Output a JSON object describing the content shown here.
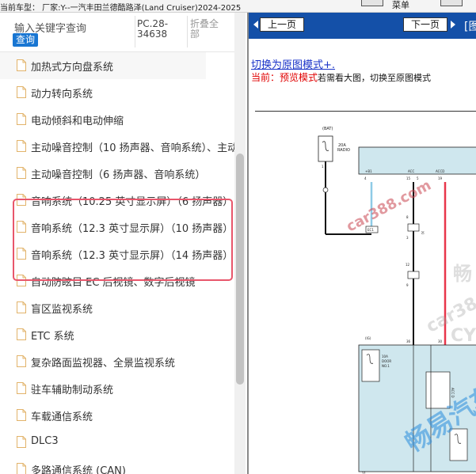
{
  "header": {
    "vehicle_info": "当前车型： 厂家:Y--一汽丰田兰德酷路泽(Land Cruiser)2024-2025",
    "menu_label": "菜单"
  },
  "sidebar": {
    "search_placeholder": "输入关键字查询",
    "search_button": "查询",
    "doc_code": "PC.28-34638",
    "fold_all": "折叠全部",
    "items": [
      {
        "label": "加热式方向盘系统"
      },
      {
        "label": "动力转向系统"
      },
      {
        "label": "电动倾斜和电动伸缩"
      },
      {
        "label": "主动噪音控制（10 扬声器、音响系统）、主动"
      },
      {
        "label": "主动噪音控制（6 扬声器、音响系统）"
      },
      {
        "label": "音响系统（10.25 英寸显示屏）（6 扬声器）"
      },
      {
        "label": "音响系统（12.3 英寸显示屏）（10 扬声器）"
      },
      {
        "label": "音响系统（12.3 英寸显示屏）（14 扬声器）"
      },
      {
        "label": "自动防眩目 EC 后视镜、数字后视镜"
      },
      {
        "label": "盲区监视系统"
      },
      {
        "label": "ETC 系统"
      },
      {
        "label": "复杂路面监视器、全景监视系统"
      },
      {
        "label": "驻车辅助制动系统"
      },
      {
        "label": "车载通信系统"
      },
      {
        "label": "DLC3"
      },
      {
        "label": "多路通信系统 (CAN)"
      }
    ]
  },
  "viewer": {
    "prev_button": "上一页",
    "next_button": "下一页",
    "nav_trail": "[图",
    "switch_link": "切换为原图模式+.",
    "mode_prefix": "当前：",
    "mode_name": "预览模式",
    "mode_rest": "若需看大图，切换至原图模式"
  },
  "diagram": {
    "labels": {
      "bat": "(BAT)",
      "fuse_radio_1": "20A",
      "fuse_radio_2": "RADIO",
      "pin_b1": "+B1",
      "pin_acc": "ACC",
      "pin_b2": "+B2",
      "pin_accd": "ACCD",
      "num_4": "4",
      "num_1": "1",
      "num_15": "15",
      "num_5": "5",
      "num_19": "19",
      "num_9": "9",
      "num_8": "8",
      "num_3": "3",
      "num_12": "12",
      "num_36": "36",
      "num_30": "30",
      "num_11": "11",
      "num_ig": "(IG)",
      "conn_xi": "XI",
      "conn_ec1": "EC1",
      "door_1": "10A",
      "door_2": "DOOR",
      "door_3": "NO.1",
      "fuse_accd": "ACC D"
    }
  },
  "watermarks": {
    "w1": "car388.com",
    "w2": "畅",
    "w3": "car38",
    "w4": "CY",
    "w5": "畅易汽车"
  },
  "colors": {
    "accent_blue": "#1976d2",
    "nav_blue": "#1450a8",
    "highlight": "#e8566b",
    "wire_red": "#e8364a",
    "wire_lightblue": "#8ecbe6",
    "diagram_fill": "#cfe7ee",
    "link_blue": "#1a33c8"
  }
}
